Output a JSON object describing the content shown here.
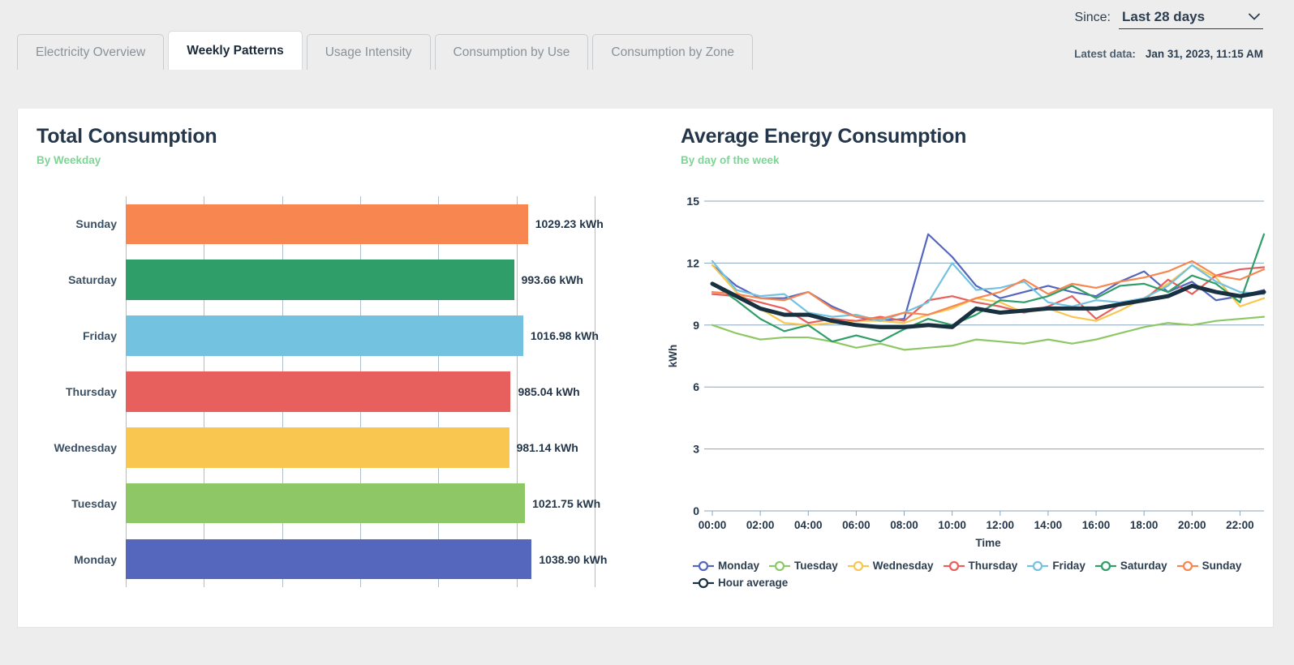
{
  "header": {
    "since_label": "Since:",
    "since_value": "Last 28 days",
    "since_options": [
      "Last 28 days"
    ],
    "chevron_icon": "chevron-down-icon",
    "latest_label": "Latest data:",
    "latest_value": "Jan 31, 2023, 11:15 AM"
  },
  "tabs": [
    {
      "label": "Electricity Overview",
      "active": false
    },
    {
      "label": "Weekly Patterns",
      "active": true
    },
    {
      "label": "Usage Intensity",
      "active": false
    },
    {
      "label": "Consumption by Use",
      "active": false
    },
    {
      "label": "Consumption by Zone",
      "active": false
    }
  ],
  "left_panel": {
    "title": "Total Consumption",
    "subtitle": "By Weekday"
  },
  "right_panel": {
    "title": "Average Energy Consumption",
    "subtitle": "By day of the week"
  },
  "colors": {
    "monday": "#5566bd",
    "tuesday": "#8ec866",
    "wednesday": "#f9c74f",
    "thursday": "#e8605d",
    "friday": "#72c2e0",
    "saturday": "#2f9e68",
    "sunday": "#f78650",
    "hour_average": "#18303f",
    "accent_green": "#7bd694",
    "title_navy": "#24364a",
    "grid": "#aebecb",
    "page_bg": "#ededed",
    "card_bg": "#ffffff"
  },
  "chart_data": [
    {
      "type": "bar",
      "orientation": "horizontal",
      "title": "Total Consumption",
      "subtitle": "By Weekday",
      "xlabel": "",
      "ylabel": "",
      "unit": "kWh",
      "grid": true,
      "xlim": [
        0,
        1200
      ],
      "gridline_values": [
        0,
        200,
        400,
        600,
        800,
        1000,
        1200
      ],
      "categories": [
        "Sunday",
        "Saturday",
        "Friday",
        "Thursday",
        "Wednesday",
        "Tuesday",
        "Monday"
      ],
      "values": [
        1029.23,
        993.66,
        1016.98,
        985.04,
        981.14,
        1021.75,
        1038.9
      ],
      "value_labels": [
        "1029.23 kWh",
        "993.66 kWh",
        "1016.98 kWh",
        "985.04 kWh",
        "981.14 kWh",
        "1021.75 kWh",
        "1038.90 kWh"
      ],
      "bar_colors": [
        "#f78650",
        "#2f9e68",
        "#72c2e0",
        "#e8605d",
        "#f9c74f",
        "#8ec866",
        "#5566bd"
      ]
    },
    {
      "type": "line",
      "title": "Average Energy Consumption",
      "subtitle": "By day of the week",
      "xlabel": "Time",
      "ylabel": "kWh",
      "grid": true,
      "legend_position": "bottom",
      "ylim": [
        0,
        15
      ],
      "yticks": [
        0,
        3,
        6,
        9,
        12,
        15
      ],
      "x": [
        "00:00",
        "01:00",
        "02:00",
        "03:00",
        "04:00",
        "05:00",
        "06:00",
        "07:00",
        "08:00",
        "09:00",
        "10:00",
        "11:00",
        "12:00",
        "13:00",
        "14:00",
        "15:00",
        "16:00",
        "17:00",
        "18:00",
        "19:00",
        "20:00",
        "21:00",
        "22:00",
        "23:00"
      ],
      "xticks": [
        "00:00",
        "02:00",
        "04:00",
        "06:00",
        "08:00",
        "10:00",
        "12:00",
        "14:00",
        "16:00",
        "18:00",
        "20:00",
        "22:00"
      ],
      "series": [
        {
          "name": "Monday",
          "color": "#5566bd",
          "values": [
            11.9,
            10.9,
            10.3,
            10.3,
            10.6,
            9.9,
            9.4,
            9.2,
            9.3,
            13.4,
            12.3,
            10.9,
            10.3,
            10.6,
            10.9,
            10.6,
            10.4,
            11.1,
            11.6,
            10.6,
            11.1,
            10.2,
            10.4,
            10.7
          ]
        },
        {
          "name": "Tuesday",
          "color": "#8ec866",
          "values": [
            9.0,
            8.6,
            8.3,
            8.4,
            8.4,
            8.2,
            7.9,
            8.1,
            7.8,
            7.9,
            8.0,
            8.3,
            8.2,
            8.1,
            8.3,
            8.1,
            8.3,
            8.6,
            8.9,
            9.1,
            9.0,
            9.2,
            9.3,
            9.4
          ]
        },
        {
          "name": "Wednesday",
          "color": "#f9c74f",
          "values": [
            11.9,
            10.6,
            9.8,
            9.1,
            9.0,
            9.1,
            9.2,
            9.2,
            9.1,
            9.5,
            9.8,
            10.3,
            10.1,
            9.6,
            9.8,
            9.4,
            9.2,
            9.7,
            10.3,
            11.0,
            11.9,
            11.3,
            9.9,
            10.3
          ]
        },
        {
          "name": "Thursday",
          "color": "#e8605d",
          "values": [
            10.5,
            10.4,
            10.1,
            9.8,
            9.1,
            9.3,
            9.2,
            9.4,
            9.2,
            10.2,
            10.4,
            10.1,
            9.9,
            9.6,
            9.9,
            10.4,
            9.3,
            10.0,
            10.2,
            11.2,
            10.5,
            11.4,
            11.7,
            11.8
          ]
        },
        {
          "name": "Friday",
          "color": "#72c2e0",
          "values": [
            12.1,
            10.7,
            10.4,
            10.5,
            9.6,
            9.4,
            9.5,
            9.2,
            9.6,
            10.1,
            12.0,
            10.7,
            10.8,
            11.1,
            10.1,
            9.9,
            10.2,
            10.1,
            10.3,
            10.9,
            11.9,
            11.1,
            10.6,
            10.5
          ]
        },
        {
          "name": "Saturday",
          "color": "#2f9e68",
          "values": [
            11.0,
            10.2,
            9.3,
            8.7,
            9.0,
            8.2,
            8.5,
            8.2,
            8.8,
            9.3,
            9.0,
            9.5,
            10.2,
            10.1,
            10.4,
            10.9,
            10.3,
            10.9,
            11.0,
            10.6,
            11.4,
            11.0,
            10.1,
            13.4
          ]
        },
        {
          "name": "Sunday",
          "color": "#f78650",
          "values": [
            10.6,
            10.5,
            10.3,
            10.2,
            10.6,
            9.8,
            9.4,
            9.3,
            9.6,
            9.5,
            9.9,
            10.3,
            10.6,
            11.2,
            10.5,
            11.0,
            10.8,
            11.1,
            11.3,
            11.6,
            12.1,
            11.4,
            11.2,
            11.7
          ]
        },
        {
          "name": "Hour average",
          "color": "#18303f",
          "width": 5,
          "values": [
            11.0,
            10.4,
            9.8,
            9.5,
            9.5,
            9.2,
            9.0,
            8.9,
            8.9,
            9.0,
            8.9,
            9.8,
            9.6,
            9.7,
            9.8,
            9.8,
            9.8,
            10.0,
            10.2,
            10.4,
            10.9,
            10.6,
            10.4,
            10.6
          ]
        }
      ]
    }
  ]
}
